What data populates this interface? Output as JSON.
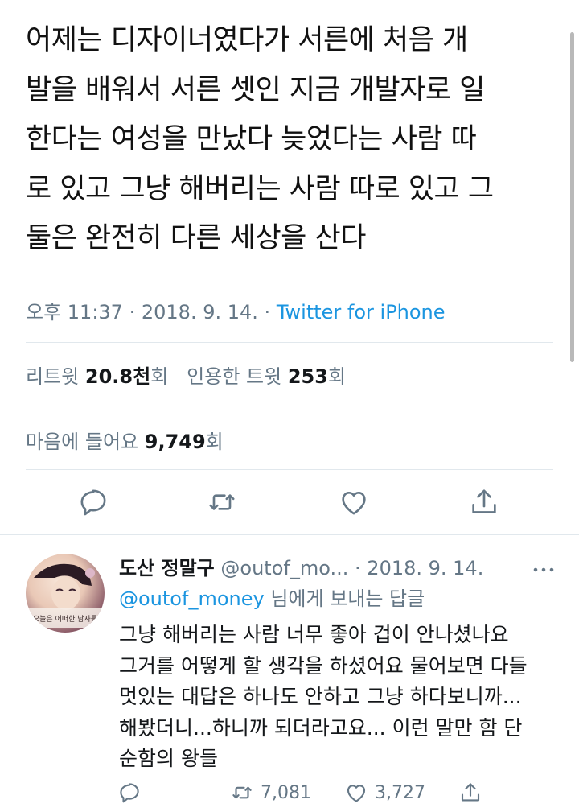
{
  "tweet": {
    "lines": [
      "어제는 디자이너였다가 서른에 처음 개",
      "발을 배워서 서른 셋인 지금 개발자로 일",
      "한다는 여성을 만났다 늦었다는 사람 따",
      "로 있고 그냥 해버리는 사람 따로 있고 그",
      "둘은 완전히 다른 세상을 산다"
    ],
    "time": "오후 11:37",
    "date": "2018. 9. 14.",
    "separator": "·",
    "source": "Twitter for iPhone"
  },
  "stats": {
    "retweet_label": "리트윗",
    "retweet_count": "20.8천",
    "retweet_unit": "회",
    "quote_label": "인용한 트윗",
    "quote_count": "253",
    "quote_unit": "회",
    "like_label": "마음에 들어요",
    "like_count": "9,749",
    "like_unit": "회"
  },
  "actions": {
    "icons": [
      "reply-icon",
      "retweet-icon",
      "like-icon",
      "share-icon"
    ]
  },
  "reply": {
    "name": "도산 정말구",
    "handle": "@outof_mo...",
    "separator": "·",
    "date": "2018. 9. 14.",
    "replying_to_mention": "@outof_money",
    "replying_to_rest": " 님에게 보내는 답글",
    "avatar_caption": "오늘은 어떠한 남자를",
    "lines": [
      "그냥 해버리는 사람 너무 좋아 겁이 안나셨나요",
      "그거를 어떻게 할 생각을 하셨어요 물어보면 다들",
      "멋있는 대답은 하나도 안하고 그냥 하다보니까...",
      "해봤더니...하니까 되더라고요... 이런 말만 함 단",
      "순함의 왕들"
    ],
    "retweet_count": "7,081",
    "like_count": "3,727"
  },
  "colors": {
    "text": "#14171a",
    "secondary": "#657786",
    "link": "#1b95e0",
    "divider": "#e1e8ed"
  }
}
